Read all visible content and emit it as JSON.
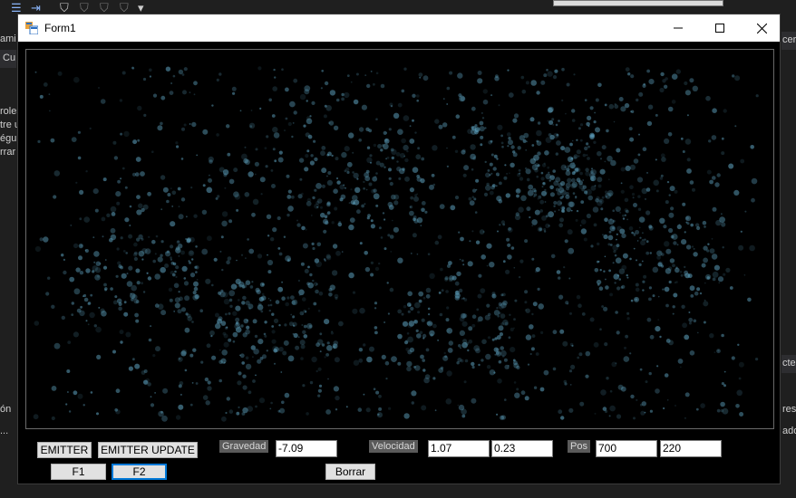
{
  "window": {
    "title": "Form1"
  },
  "ide_background": {
    "left_fragments": [
      "ami",
      "Cu",
      "roles",
      "tre u",
      "égu",
      "rrar",
      "ón",
      "..."
    ],
    "right_fragments": [
      "cera",
      "cte",
      "res",
      "ado"
    ]
  },
  "buttons": {
    "emitter": "EMITTER",
    "emitter_update": "EMITTER UPDATE",
    "f1": "F1",
    "f2": "F2",
    "borrar": "Borrar"
  },
  "labels": {
    "gravedad": "Gravedad",
    "velocidad": "Velocidad",
    "pos": "Pos"
  },
  "fields": {
    "gravedad": "-7.09",
    "velocidad_x": "1.07",
    "velocidad_y": "0.23",
    "pos_x": "700",
    "pos_y": "220"
  },
  "colors": {
    "particle": "#5fa3c0",
    "canvas_bg": "#000000",
    "focus": "#0078d7"
  }
}
